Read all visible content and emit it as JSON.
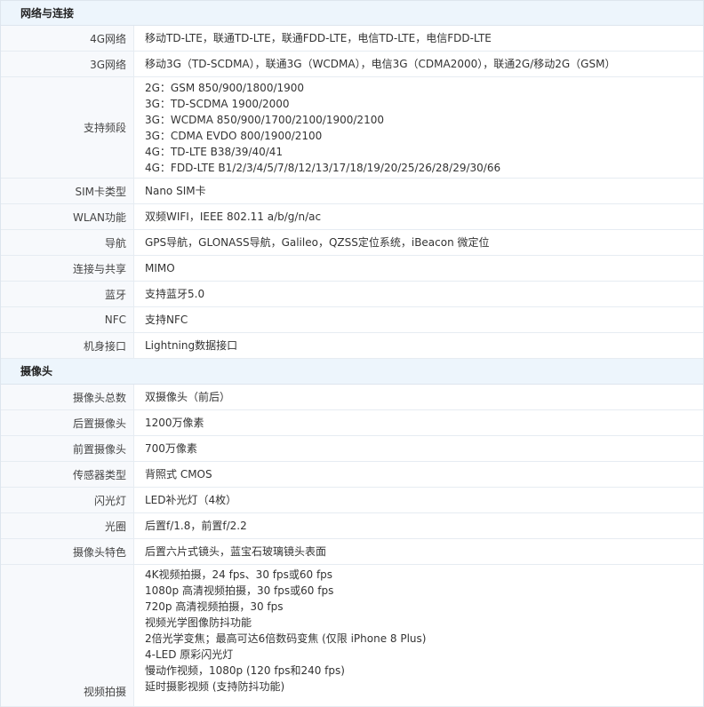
{
  "sections": [
    {
      "title": "网络与连接",
      "rows": [
        {
          "key": "4G网络",
          "values": [
            "移动TD-LTE，联通TD-LTE，联通FDD-LTE，电信TD-LTE，电信FDD-LTE"
          ]
        },
        {
          "key": "3G网络",
          "values": [
            "移动3G（TD-SCDMA），联通3G（WCDMA），电信3G（CDMA2000），联通2G/移动2G（GSM）"
          ]
        },
        {
          "key": "支持频段",
          "values": [
            "2G：GSM 850/900/1800/1900",
            "3G：TD-SCDMA 1900/2000",
            "3G：WCDMA 850/900/1700/2100/1900/2100",
            "3G：CDMA EVDO 800/1900/2100",
            "4G：TD-LTE B38/39/40/41",
            "4G：FDD-LTE B1/2/3/4/5/7/8/12/13/17/18/19/20/25/26/28/29/30/66"
          ]
        },
        {
          "key": "SIM卡类型",
          "values": [
            "Nano SIM卡"
          ]
        },
        {
          "key": "WLAN功能",
          "values": [
            "双频WIFI，IEEE 802.11 a/b/g/n/ac"
          ]
        },
        {
          "key": "导航",
          "values": [
            "GPS导航，GLONASS导航，Galileo，QZSS定位系统，iBeacon 微定位"
          ]
        },
        {
          "key": "连接与共享",
          "values": [
            "MIMO"
          ]
        },
        {
          "key": "蓝牙",
          "values": [
            "支持蓝牙5.0"
          ]
        },
        {
          "key": "NFC",
          "values": [
            "支持NFC"
          ]
        },
        {
          "key": "机身接口",
          "values": [
            "Lightning数据接口"
          ]
        }
      ]
    },
    {
      "title": "摄像头",
      "rows": [
        {
          "key": "摄像头总数",
          "values": [
            "双摄像头（前后）"
          ]
        },
        {
          "key": "后置摄像头",
          "values": [
            "1200万像素"
          ]
        },
        {
          "key": "前置摄像头",
          "values": [
            "700万像素"
          ]
        },
        {
          "key": "传感器类型",
          "values": [
            "背照式 CMOS"
          ]
        },
        {
          "key": "闪光灯",
          "values": [
            "LED补光灯（4枚）"
          ]
        },
        {
          "key": "光圈",
          "values": [
            "后置f/1.8，前置f/2.2"
          ]
        },
        {
          "key": "摄像头特色",
          "values": [
            "后置六片式镜头，蓝宝石玻璃镜头表面"
          ]
        },
        {
          "key": "视频拍摄",
          "values": [
            "4K视频拍摄，24 fps、30 fps或60 fps",
            "1080p 高清视频拍摄，30 fps或60 fps",
            "720p 高清视频拍摄，30 fps",
            "视频光学图像防抖功能",
            "2倍光学变焦；最高可达6倍数码变焦 (仅限 iPhone 8 Plus)",
            "4-LED 原彩闪光灯",
            "慢动作视频，1080p (120 fps和240 fps)",
            "延时摄影视频 (支持防抖功能)"
          ]
        }
      ]
    }
  ]
}
